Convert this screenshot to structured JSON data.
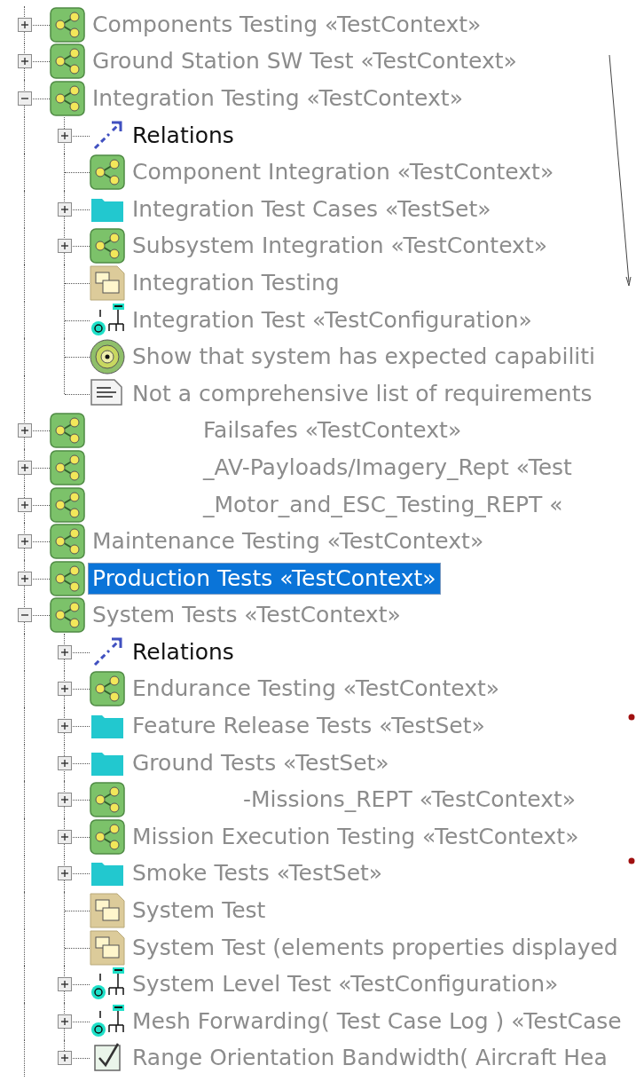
{
  "tree": [
    {
      "kind": "context",
      "label": "Components Testing «TestContext»",
      "expanded": false,
      "selected": false
    },
    {
      "kind": "context",
      "label": "Ground Station SW Test «TestContext»",
      "expanded": false,
      "selected": false
    },
    {
      "kind": "context",
      "label": "Integration Testing «TestContext»",
      "expanded": true,
      "selected": false,
      "children": [
        {
          "kind": "relations",
          "label": "Relations",
          "expanded": false,
          "selected": false
        },
        {
          "kind": "context",
          "label": "Component Integration «TestContext»",
          "selected": false
        },
        {
          "kind": "folder",
          "label": "Integration Test Cases «TestSet»",
          "expanded": false,
          "selected": false
        },
        {
          "kind": "context",
          "label": "Subsystem Integration «TestContext»",
          "expanded": false,
          "selected": false
        },
        {
          "kind": "diagram",
          "label": "Integration Testing",
          "selected": false
        },
        {
          "kind": "config",
          "label": "Integration Test «TestConfiguration»",
          "selected": false
        },
        {
          "kind": "goal",
          "label": "Show that system has expected capabiliti",
          "selected": false
        },
        {
          "kind": "note",
          "label": "Not a comprehensive list of requirements",
          "selected": false
        }
      ]
    },
    {
      "kind": "context",
      "label": "Failsafes «TestContext»",
      "redacted": true,
      "expanded": false,
      "selected": false
    },
    {
      "kind": "context",
      "label": "_AV-Payloads/Imagery_Rept «Test",
      "redacted": true,
      "expanded": false,
      "selected": false
    },
    {
      "kind": "context",
      "label": "_Motor_and_ESC_Testing_REPT «",
      "redacted": true,
      "expanded": false,
      "selected": false
    },
    {
      "kind": "context",
      "label": "Maintenance Testing «TestContext»",
      "expanded": false,
      "selected": false
    },
    {
      "kind": "context",
      "label": "Production Tests «TestContext»",
      "expanded": false,
      "selected": true
    },
    {
      "kind": "context",
      "label": "System Tests «TestContext»",
      "expanded": true,
      "selected": false,
      "children": [
        {
          "kind": "relations",
          "label": "Relations",
          "expanded": false,
          "selected": false
        },
        {
          "kind": "context",
          "label": "Endurance Testing «TestContext»",
          "expanded": false,
          "selected": false
        },
        {
          "kind": "folder",
          "label": "Feature Release Tests «TestSet»",
          "expanded": false,
          "selected": false
        },
        {
          "kind": "folder",
          "label": "Ground Tests «TestSet»",
          "expanded": false,
          "selected": false
        },
        {
          "kind": "context",
          "label": "-Missions_REPT «TestContext»",
          "redacted": true,
          "expanded": false,
          "selected": false
        },
        {
          "kind": "context",
          "label": "Mission Execution Testing «TestContext»",
          "expanded": false,
          "selected": false
        },
        {
          "kind": "folder",
          "label": "Smoke Tests «TestSet»",
          "expanded": false,
          "selected": false
        },
        {
          "kind": "diagram",
          "label": "System Test",
          "selected": false
        },
        {
          "kind": "diagram",
          "label": "System Test (elements properties displayed",
          "selected": false
        },
        {
          "kind": "config",
          "label": "System Level Test «TestConfiguration»",
          "expanded": false,
          "selected": false
        },
        {
          "kind": "config",
          "label": "Mesh Forwarding( Test Case Log ) «TestCase",
          "expanded": false,
          "selected": false
        },
        {
          "kind": "check",
          "label": "Range Orientation Bandwidth( Aircraft Hea",
          "expanded": false,
          "selected": false
        }
      ]
    }
  ]
}
